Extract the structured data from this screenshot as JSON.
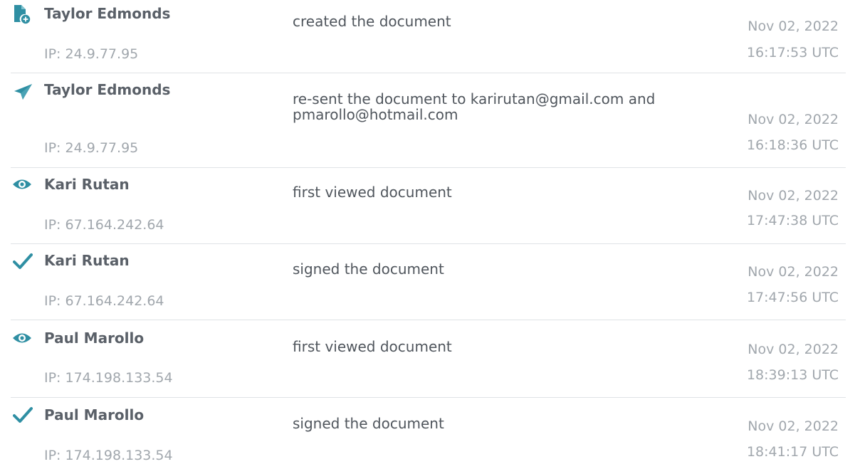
{
  "colors": {
    "icon": "#2f8fa3",
    "name": "#5a6068",
    "muted": "#a1a7ad",
    "divider": "#dfe3e6"
  },
  "events": [
    {
      "icon": "document-add-icon",
      "name": "Taylor Edmonds",
      "ip": "IP: 24.9.77.95",
      "action": "created the document",
      "date": "Nov 02, 2022",
      "time": "16:17:53 UTC"
    },
    {
      "icon": "paper-plane-icon",
      "name": "Taylor Edmonds",
      "ip": "IP: 24.9.77.95",
      "action": "re-sent the document to karirutan@gmail.com and pmarollo@hotmail.com",
      "date": "Nov 02, 2022",
      "time": "16:18:36 UTC"
    },
    {
      "icon": "eye-icon",
      "name": "Kari Rutan",
      "ip": "IP: 67.164.242.64",
      "action": "first viewed document",
      "date": "Nov 02, 2022",
      "time": "17:47:38 UTC"
    },
    {
      "icon": "checkmark-icon",
      "name": "Kari Rutan",
      "ip": "IP: 67.164.242.64",
      "action": "signed the document",
      "date": "Nov 02, 2022",
      "time": "17:47:56 UTC"
    },
    {
      "icon": "eye-icon",
      "name": "Paul Marollo",
      "ip": "IP: 174.198.133.54",
      "action": "first viewed document",
      "date": "Nov 02, 2022",
      "time": "18:39:13 UTC"
    },
    {
      "icon": "checkmark-icon",
      "name": "Paul Marollo",
      "ip": "IP: 174.198.133.54",
      "action": "signed the document",
      "date": "Nov 02, 2022",
      "time": "18:41:17 UTC"
    }
  ]
}
